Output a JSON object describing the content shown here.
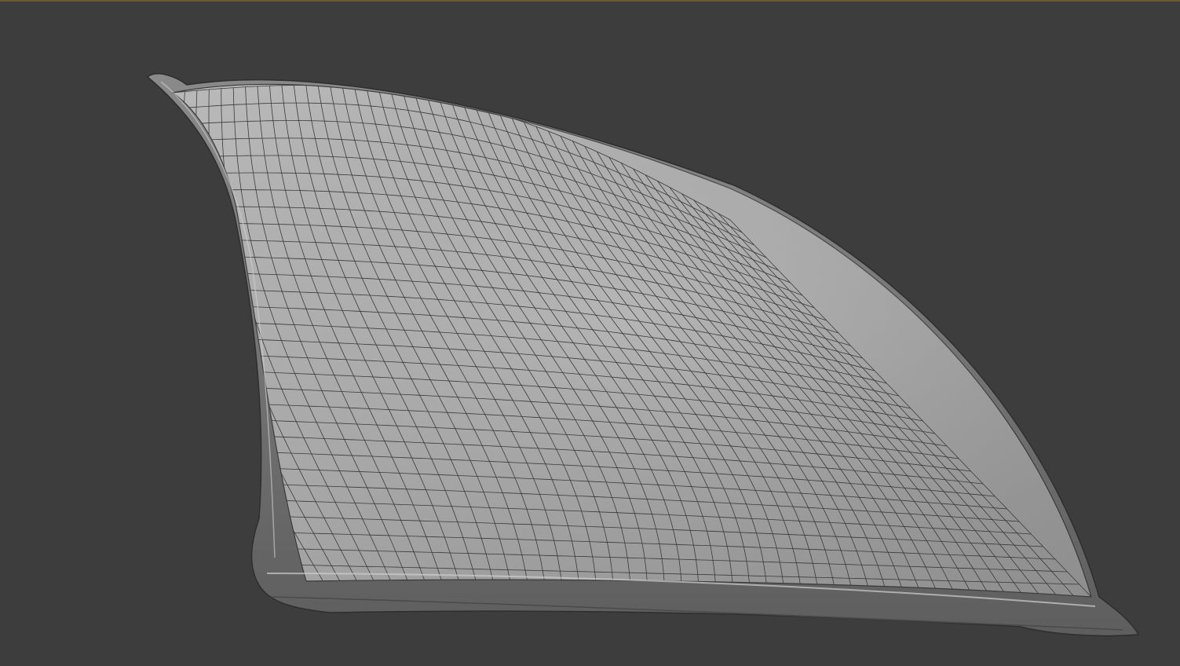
{
  "viewport": {
    "background_color": "#3d3d3d",
    "top_border_color": "#6b5a2e",
    "shading_mode": "solid-wireframe"
  },
  "object": {
    "kind": "pillow-mesh",
    "surface_color": "#a3a3a3",
    "highlight_color": "#c4c4c4",
    "shadow_color": "#6f6f6f",
    "wire_color": "#3a3a3a"
  }
}
